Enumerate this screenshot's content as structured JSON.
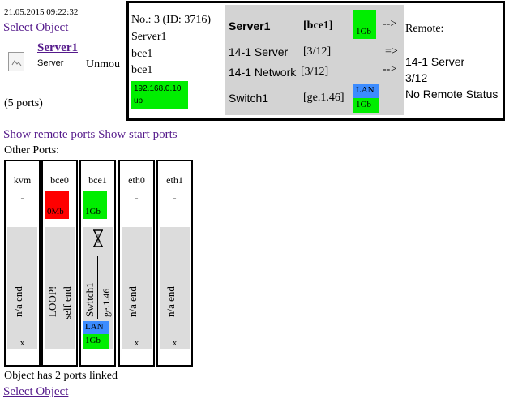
{
  "header": {
    "datetime": "21.05.2015 09:22:32",
    "select_object": "Select Object"
  },
  "object": {
    "name": "Server1",
    "type": "Server",
    "truncated_text": "Unmou",
    "ports_count": "(5 ports)"
  },
  "popup": {
    "left": {
      "number_id": "No.: 3 (ID: 3716)",
      "object": "Server1",
      "port1": "bce1",
      "port2": "bce1",
      "ip": "192.168.0.10",
      "state": "up"
    },
    "middle": {
      "server": "Server1",
      "port": "[bce1]",
      "speed": "1Gb",
      "row2_name": "14-1 Server",
      "row2_val": "[3/12]",
      "row3_name": "14-1 Network",
      "row3_val": "[3/12]",
      "switch": "Switch1",
      "switch_port": "[ge.1.46]",
      "lan": "LAN",
      "lan_speed": "1Gb"
    },
    "arrows": {
      "a1": "-->",
      "a2": "=>",
      "a3": "-->"
    },
    "right": {
      "remote": "Remote:",
      "remote_name": "14-1 Server",
      "remote_port": "3/12",
      "status": "No Remote Status"
    }
  },
  "links": {
    "show_remote": "Show remote ports",
    "show_start": "Show start ports"
  },
  "other_ports_label": "Other Ports:",
  "ports": [
    {
      "name": "kvm",
      "top": "-",
      "speed": "",
      "vtext1": "n/a end",
      "vtext2": "",
      "x": "x"
    },
    {
      "name": "bce0",
      "top": "",
      "speed": "0Mb",
      "vtext1": "LOOP!",
      "vtext2": "self end",
      "x": ""
    },
    {
      "name": "bce1",
      "top": "",
      "speed": "1Gb",
      "vtext1": "Switch1",
      "vtext2": "ge.1.46",
      "lan": "LAN",
      "lan_speed": "1Gb",
      "x": ""
    },
    {
      "name": "eth0",
      "top": "-",
      "speed": "",
      "vtext1": "n/a end",
      "vtext2": "",
      "x": "x"
    },
    {
      "name": "eth1",
      "top": "-",
      "speed": "",
      "vtext1": "n/a end",
      "vtext2": "",
      "x": "x"
    }
  ],
  "footer": {
    "linked_text": "Object has 2 ports linked",
    "select_object": "Select Object"
  },
  "colors": {
    "up_green": "#00ee00",
    "down_red": "#ff0000",
    "lan_blue": "#3c8cff",
    "grey": "#d3d3d3"
  },
  "icons": {
    "object_icon": "document-icon",
    "hourglass": "hourglass-icon"
  }
}
